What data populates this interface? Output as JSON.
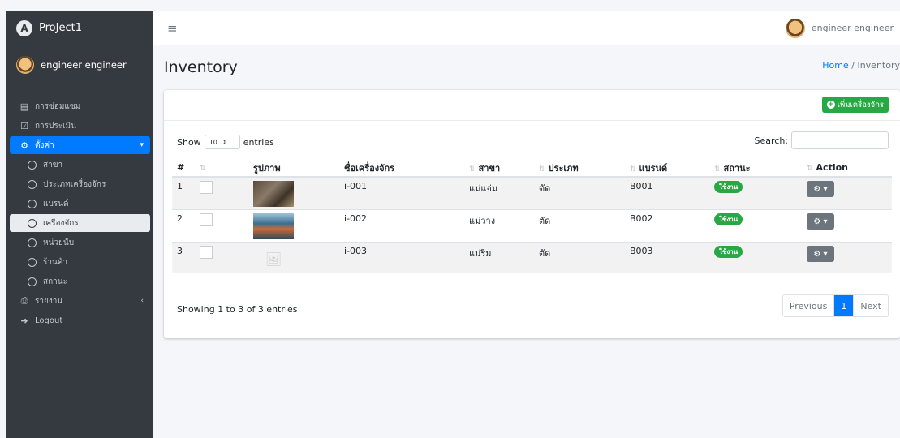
{
  "brand": {
    "name": "ProJect1"
  },
  "sidebar": {
    "user": "engineer engineer",
    "items": [
      {
        "label": "การซ่อมแซม",
        "icon": "clipboard-icon"
      },
      {
        "label": "การประเมิน",
        "icon": "check-square-icon"
      },
      {
        "label": "ตั้งค่า",
        "icon": "gear-icon"
      }
    ],
    "sub_items": [
      "สาขา",
      "ประเภทเครื่องจักร",
      "แบรนด์",
      "เครื่องจักร",
      "หน่วยนับ",
      "ร้านค้า",
      "สถานะ"
    ],
    "report": "รายงาน",
    "logout": "Logout"
  },
  "topbar": {
    "user": "engineer engineer"
  },
  "page": {
    "title": "Inventory",
    "crumb_home": "Home",
    "crumb_sep": "/",
    "crumb_current": "Inventory"
  },
  "card": {
    "add_button": "เพิ่มเครื่องจักร"
  },
  "table_controls": {
    "show": "Show",
    "length": "10",
    "entries": "entries",
    "search": "Search:"
  },
  "table": {
    "headers": [
      "#",
      "",
      "รูปภาพ",
      "ชื่อเครื่องจักร",
      "สาขา",
      "ประเภท",
      "แบรนด์",
      "สถานะ",
      "Action"
    ],
    "rows": [
      {
        "no": "1",
        "name": "i-001",
        "branch": "แม่แจ่ม",
        "type": "ตัด",
        "brand": "B001",
        "status": "ใช้งาน"
      },
      {
        "no": "2",
        "name": "i-002",
        "branch": "แม่วาง",
        "type": "ตัด",
        "brand": "B002",
        "status": "ใช้งาน"
      },
      {
        "no": "3",
        "name": "i-003",
        "branch": "แม่ริม",
        "type": "ตัด",
        "brand": "B003",
        "status": "ใช้งาน"
      }
    ]
  },
  "footer": {
    "info": "Showing 1 to 3 of 3 entries",
    "previous": "Previous",
    "page": "1",
    "next": "Next"
  },
  "colors": {
    "accent": "#007bff",
    "success": "#28a745",
    "sidebar": "#343a40"
  }
}
